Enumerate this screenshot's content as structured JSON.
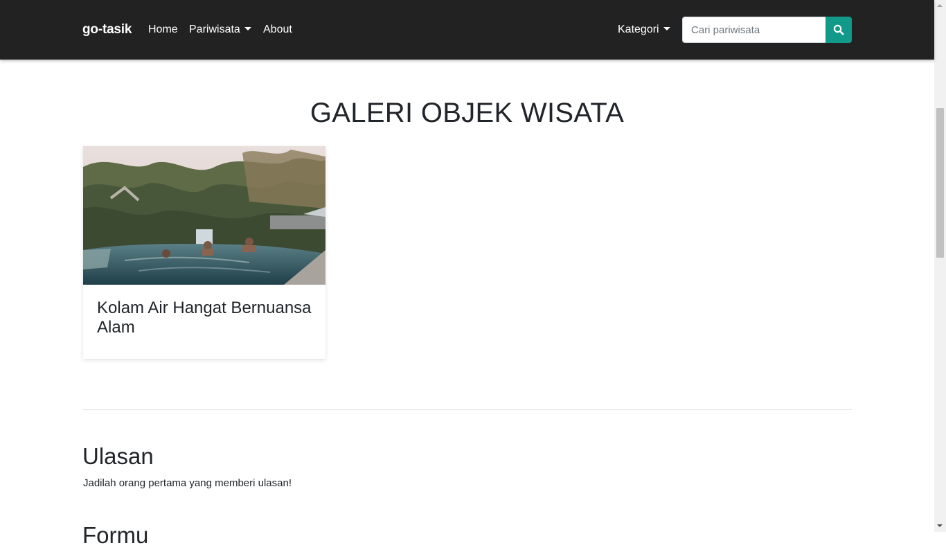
{
  "navbar": {
    "brand": "go-tasik",
    "links": [
      {
        "label": "Home"
      },
      {
        "label": "Pariwisata"
      },
      {
        "label": "About"
      }
    ],
    "category_label": "Kategori",
    "search": {
      "placeholder": "Cari pariwisata",
      "value": "",
      "button_icon": "search-icon"
    }
  },
  "main": {
    "title": "GALERI OBJEK WISATA",
    "cards": [
      {
        "title": "Kolam Air Hangat Bernuansa Alam"
      }
    ]
  },
  "reviews": {
    "title": "Ulasan",
    "empty_text": "Jadilah orang pertama yang memberi ulasan!",
    "next_heading": "Formu"
  },
  "colors": {
    "navbar_bg": "#222222",
    "accent": "#11998a",
    "text": "#212529"
  }
}
